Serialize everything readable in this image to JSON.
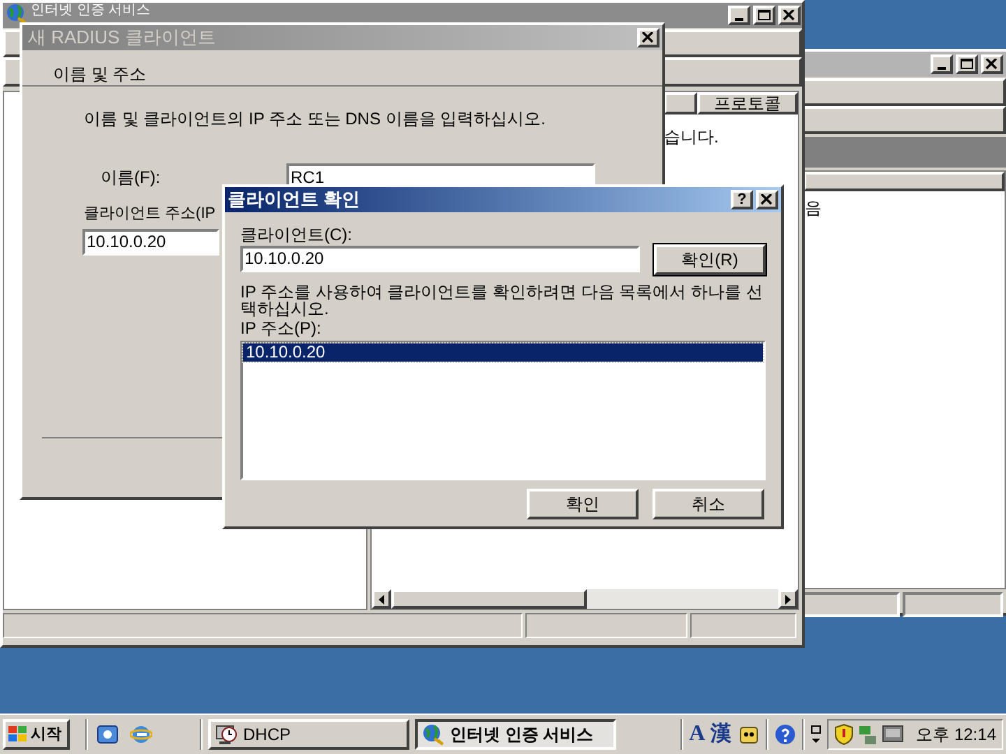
{
  "back_window": {
    "list_text": "음"
  },
  "main_window": {
    "title": "인터넷 인증 서비스",
    "column_header": "프로토콜",
    "list_text": "습니다."
  },
  "radius_dialog": {
    "title": "새 RADIUS 클라이언트",
    "section": "이름 및 주소",
    "instruction": "이름 및 클라이언트의 IP 주소 또는 DNS 이름을 입력하십시오.",
    "name_label": "이름(F):",
    "name_value": "RC1",
    "address_label": "클라이언트 주소(IP",
    "address_value": "10.10.0.20"
  },
  "verify_dialog": {
    "title": "클라이언트 확인",
    "help_button": "?",
    "client_label": "클라이언트(C):",
    "client_value": "10.10.0.20",
    "verify_button": "확인(R)",
    "instruction": "IP 주소를 사용하여 클라이언트를 확인하려면 다음 목록에서 하나를 선택하십시오.",
    "ip_label": "IP 주소(P):",
    "ip_list": [
      {
        "text": "10.10.0.20",
        "selected": true
      }
    ],
    "buttons": [
      "확인",
      "취소"
    ]
  },
  "taskbar": {
    "start": "시작",
    "tasks": [
      {
        "label": "DHCP",
        "selected": false
      },
      {
        "label": "인터넷 인증 서비스",
        "selected": true
      }
    ],
    "ime": [
      "A",
      "漢"
    ],
    "clock": "오후 12:14"
  }
}
